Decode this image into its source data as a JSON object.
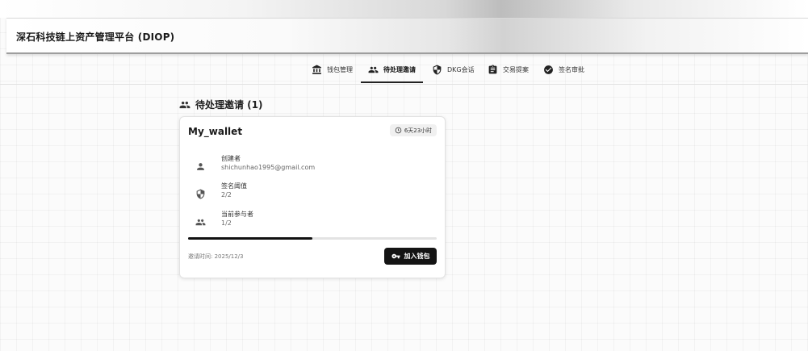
{
  "app": {
    "title": "深石科技链上资产管理平台 (DIOP)"
  },
  "nav": {
    "tabs": [
      {
        "label": "钱包管理",
        "icon": "bank-icon",
        "active": false
      },
      {
        "label": "待处理邀请",
        "icon": "group-icon",
        "active": true
      },
      {
        "label": "DKG会话",
        "icon": "shield-icon",
        "active": false
      },
      {
        "label": "交易提案",
        "icon": "clipboard-icon",
        "active": false
      },
      {
        "label": "签名审批",
        "icon": "check-circle-icon",
        "active": false
      }
    ]
  },
  "section": {
    "title": "待处理邀请 (1)",
    "icon": "group-icon"
  },
  "invitation": {
    "wallet_name": "My_wallet",
    "time_left": "6天23小时",
    "creator_label": "创建者",
    "creator_value": "shichunhao1995@gmail.com",
    "threshold_label": "签名阈值",
    "threshold_value": "2/2",
    "participants_label": "当前参与者",
    "participants_value": "1/2",
    "progress": 0.5,
    "invite_time": "邀请时间: 2025/12/3",
    "join_label": "加入钱包"
  },
  "colors": {
    "primary": "#141414",
    "accent_underline": "#222222",
    "track": "#e3e3e3"
  }
}
